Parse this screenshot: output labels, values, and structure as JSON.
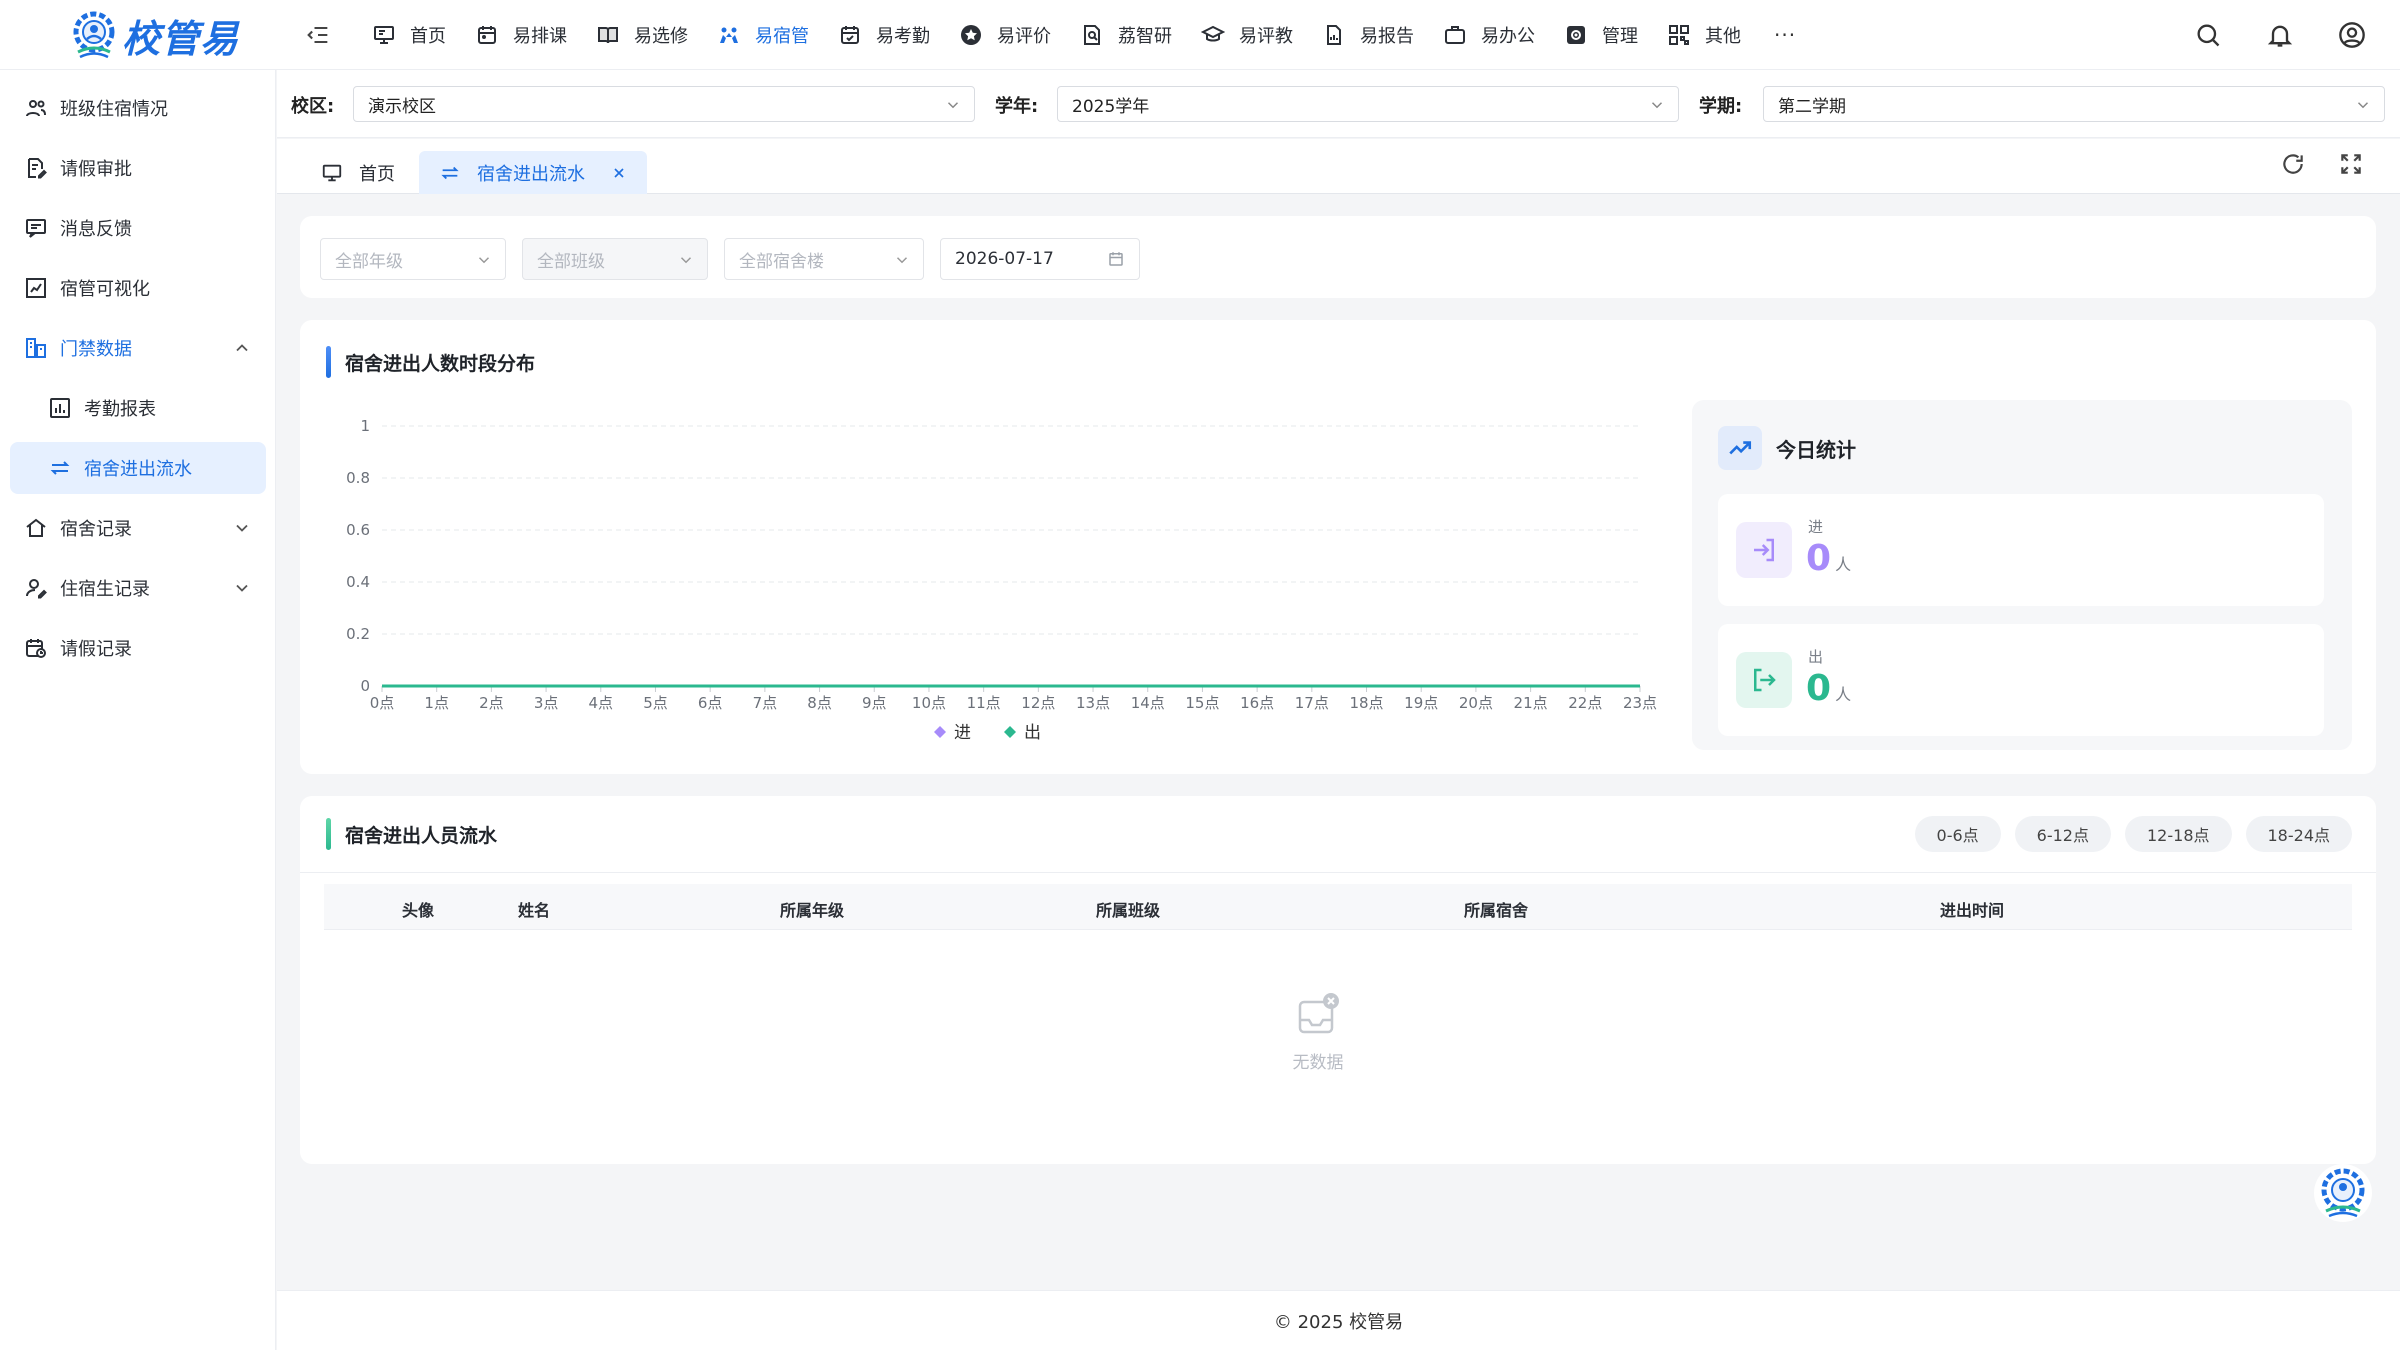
{
  "app": {
    "logo_text": "校管易",
    "accent_color": "#1e6fe0"
  },
  "topnav": {
    "items": [
      {
        "label": "首页",
        "icon": "monitor-icon"
      },
      {
        "label": "易排课",
        "icon": "calendar-icon"
      },
      {
        "label": "易选修",
        "icon": "book-icon"
      },
      {
        "label": "易宿管",
        "icon": "people-icon",
        "active": true
      },
      {
        "label": "易考勤",
        "icon": "calendar-check-icon"
      },
      {
        "label": "易评价",
        "icon": "star-icon"
      },
      {
        "label": "荔智研",
        "icon": "research-icon"
      },
      {
        "label": "易评教",
        "icon": "graduation-cap-icon"
      },
      {
        "label": "易报告",
        "icon": "report-icon"
      },
      {
        "label": "易办公",
        "icon": "briefcase-icon"
      },
      {
        "label": "管理",
        "icon": "settings-icon"
      },
      {
        "label": "其他",
        "icon": "grid-icon"
      }
    ],
    "more_label": "···"
  },
  "sidebar": {
    "items": [
      {
        "label": "班级住宿情况",
        "icon": "group-icon"
      },
      {
        "label": "请假审批",
        "icon": "doc-edit-icon"
      },
      {
        "label": "消息反馈",
        "icon": "message-icon"
      },
      {
        "label": "宿管可视化",
        "icon": "chart-icon"
      },
      {
        "label": "门禁数据",
        "icon": "access-icon"
      },
      {
        "label": "考勤报表",
        "icon": "bar-chart-icon"
      },
      {
        "label": "宿舍进出流水",
        "icon": "swap-icon"
      },
      {
        "label": "宿舍记录",
        "icon": "home-icon"
      },
      {
        "label": "住宿生记录",
        "icon": "user-edit-icon"
      },
      {
        "label": "请假记录",
        "icon": "calendar-clock-icon"
      }
    ]
  },
  "scope": {
    "campus_label": "校区:",
    "campus_value": "演示校区",
    "year_label": "学年:",
    "year_value": "2025学年",
    "term_label": "学期:",
    "term_value": "第二学期"
  },
  "tabs": {
    "home": "首页",
    "current": "宿舍进出流水"
  },
  "filters": {
    "grade_placeholder": "全部年级",
    "class_placeholder": "全部班级",
    "building_placeholder": "全部宿舍楼",
    "date_value": "2026-07-17"
  },
  "chart_section": {
    "title": "宿舍进出人数时段分布"
  },
  "chart_data": {
    "type": "line",
    "title": "",
    "xlabel": "",
    "ylabel": "",
    "categories": [
      "0点",
      "1点",
      "2点",
      "3点",
      "4点",
      "5点",
      "6点",
      "7点",
      "8点",
      "9点",
      "10点",
      "11点",
      "12点",
      "13点",
      "14点",
      "15点",
      "16点",
      "17点",
      "18点",
      "19点",
      "20点",
      "21点",
      "22点",
      "23点"
    ],
    "y_ticks": [
      "0",
      "0.2",
      "0.4",
      "0.6",
      "0.8",
      "1"
    ],
    "ylim": [
      0,
      1
    ],
    "grid": true,
    "legend_position": "bottom",
    "series": [
      {
        "name": "进",
        "color": "#a78bfa",
        "values": [
          0,
          0,
          0,
          0,
          0,
          0,
          0,
          0,
          0,
          0,
          0,
          0,
          0,
          0,
          0,
          0,
          0,
          0,
          0,
          0,
          0,
          0,
          0,
          0
        ]
      },
      {
        "name": "出",
        "color": "#2bb88f",
        "values": [
          0,
          0,
          0,
          0,
          0,
          0,
          0,
          0,
          0,
          0,
          0,
          0,
          0,
          0,
          0,
          0,
          0,
          0,
          0,
          0,
          0,
          0,
          0,
          0
        ]
      }
    ]
  },
  "stats": {
    "title": "今日统计",
    "in_label": "进",
    "in_value": "0",
    "in_unit": "人",
    "out_label": "出",
    "out_value": "0",
    "out_unit": "人",
    "in_color": "#a78bfa",
    "out_color": "#2bb88f"
  },
  "flow_section": {
    "title": "宿舍进出人员流水",
    "time_ranges": [
      "0-6点",
      "6-12点",
      "12-18点",
      "18-24点"
    ],
    "columns": [
      "头像",
      "姓名",
      "所属年级",
      "所属班级",
      "所属宿舍",
      "进出时间"
    ],
    "empty_text": "无数据"
  },
  "footer": {
    "copyright": "© 2025 校管易"
  }
}
